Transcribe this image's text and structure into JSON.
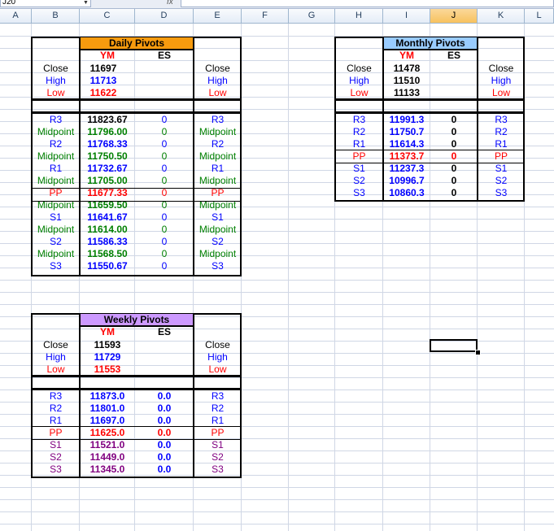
{
  "formula_bar": {
    "name_box": "J20",
    "fx": "fx",
    "formula": ""
  },
  "columns": [
    "A",
    "B",
    "C",
    "D",
    "E",
    "F",
    "G",
    "H",
    "I",
    "J",
    "K",
    "L"
  ],
  "daily": {
    "title": "Daily Pivots",
    "ym": "YM",
    "es": "ES",
    "close_label": "Close",
    "high_label": "High",
    "low_label": "Low",
    "close": "11697",
    "high": "11713",
    "low": "11622",
    "rows": [
      {
        "l": "R3",
        "v": "11823.67",
        "es": "0",
        "r": "R3"
      },
      {
        "l": "Midpoint",
        "v": "11796.00",
        "es": "0",
        "r": "Midpoint"
      },
      {
        "l": "R2",
        "v": "11768.33",
        "es": "0",
        "r": "R2"
      },
      {
        "l": "Midpoint",
        "v": "11750.50",
        "es": "0",
        "r": "Midpoint"
      },
      {
        "l": "R1",
        "v": "11732.67",
        "es": "0",
        "r": "R1"
      },
      {
        "l": "Midpoint",
        "v": "11705.00",
        "es": "0",
        "r": "Midpoint"
      },
      {
        "l": "PP",
        "v": "11677.33",
        "es": "0",
        "r": "PP"
      },
      {
        "l": "Midpoint",
        "v": "11659.50",
        "es": "0",
        "r": "Midpoint"
      },
      {
        "l": "S1",
        "v": "11641.67",
        "es": "0",
        "r": "S1"
      },
      {
        "l": "Midpoint",
        "v": "11614.00",
        "es": "0",
        "r": "Midpoint"
      },
      {
        "l": "S2",
        "v": "11586.33",
        "es": "0",
        "r": "S2"
      },
      {
        "l": "Midpoint",
        "v": "11568.50",
        "es": "0",
        "r": "Midpoint"
      },
      {
        "l": "S3",
        "v": "11550.67",
        "es": "0",
        "r": "S3"
      }
    ]
  },
  "monthly": {
    "title": "Monthly Pivots",
    "ym": "YM",
    "es": "ES",
    "close_label": "Close",
    "high_label": "High",
    "low_label": "Low",
    "close": "11478",
    "high": "11510",
    "low": "11133",
    "rows": [
      {
        "l": "R3",
        "v": "11991.3",
        "es": "0",
        "r": "R3"
      },
      {
        "l": "R2",
        "v": "11750.7",
        "es": "0",
        "r": "R2"
      },
      {
        "l": "R1",
        "v": "11614.3",
        "es": "0",
        "r": "R1"
      },
      {
        "l": "PP",
        "v": "11373.7",
        "es": "0",
        "r": "PP"
      },
      {
        "l": "S1",
        "v": "11237.3",
        "es": "0",
        "r": "S1"
      },
      {
        "l": "S2",
        "v": "10996.7",
        "es": "0",
        "r": "S2"
      },
      {
        "l": "S3",
        "v": "10860.3",
        "es": "0",
        "r": "S3"
      }
    ]
  },
  "weekly": {
    "title": "Weekly Pivots",
    "ym": "YM",
    "es": "ES",
    "close_label": "Close",
    "high_label": "High",
    "low_label": "Low",
    "close": "11593",
    "high": "11729",
    "low": "11553",
    "rows": [
      {
        "l": "R3",
        "v": "11873.0",
        "es": "0.0",
        "r": "R3"
      },
      {
        "l": "R2",
        "v": "11801.0",
        "es": "0.0",
        "r": "R2"
      },
      {
        "l": "R1",
        "v": "11697.0",
        "es": "0.0",
        "r": "R1"
      },
      {
        "l": "PP",
        "v": "11625.0",
        "es": "0.0",
        "r": "PP"
      },
      {
        "l": "S1",
        "v": "11521.0",
        "es": "0.0",
        "r": "S1"
      },
      {
        "l": "S2",
        "v": "11449.0",
        "es": "0.0",
        "r": "S2"
      },
      {
        "l": "S3",
        "v": "11345.0",
        "es": "0.0",
        "r": "S3"
      }
    ]
  },
  "colors": {
    "daily_title_bg": "#f79b0e",
    "monthly_title_bg": "#99ccff",
    "weekly_title_bg": "#cc99ff"
  }
}
